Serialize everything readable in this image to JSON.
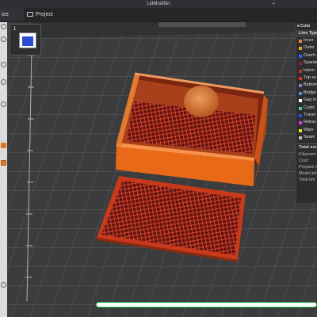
{
  "window": {
    "title": "LidModifier"
  },
  "tabs": {
    "prepare": "ice",
    "project": "Project"
  },
  "plate": {
    "number": "1"
  },
  "legend": {
    "header": "Colo",
    "subheader": "Line Type",
    "items": [
      {
        "label": "Inner",
        "color": "#e8863a"
      },
      {
        "label": "Outer",
        "color": "#e8a020"
      },
      {
        "label": "Overh",
        "color": "#2f5fff"
      },
      {
        "label": "Sparse",
        "color": "#9a1a3a"
      },
      {
        "label": "Intern",
        "color": "#c8302c"
      },
      {
        "label": "Top su",
        "color": "#e03030"
      },
      {
        "label": "Bottom",
        "color": "#9a7ac8"
      },
      {
        "label": "Bridge",
        "color": "#4a8ae0"
      },
      {
        "label": "Gap in",
        "color": "#ffffff"
      },
      {
        "label": "Custo",
        "color": "#50c8a0"
      },
      {
        "label": "Travel",
        "color": "#2050e0"
      },
      {
        "label": "Retrac",
        "color": "#e040e0"
      },
      {
        "label": "Wipe",
        "color": "#f0e020"
      },
      {
        "label": "Seam",
        "color": "#b8b8b8"
      }
    ],
    "total_header": "Total est",
    "stats": [
      "Filament",
      "Cost:",
      "Prepare t",
      "Model pri",
      "Total tim"
    ]
  },
  "progress": {
    "value": 1.0,
    "color": "#1fbf4a"
  },
  "colors": {
    "accent": "#e07a1e",
    "model_orange": "#e86a18",
    "infill_red": "#8a1c14"
  }
}
